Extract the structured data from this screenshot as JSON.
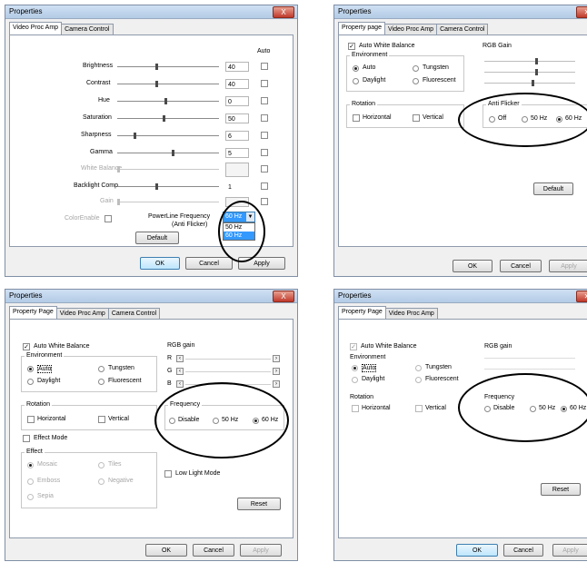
{
  "p1": {
    "title": "Properties",
    "close": "X",
    "tabs": [
      "Video Proc Amp",
      "Camera Control"
    ],
    "auto_header": "Auto",
    "rows": [
      {
        "label": "Brightness",
        "value": "40"
      },
      {
        "label": "Contrast",
        "value": "40"
      },
      {
        "label": "Hue",
        "value": "0"
      },
      {
        "label": "Saturation",
        "value": "50"
      },
      {
        "label": "Sharpness",
        "value": "6"
      },
      {
        "label": "Gamma",
        "value": "5"
      },
      {
        "label": "White Balance",
        "value": ""
      },
      {
        "label": "Backlight Comp",
        "value": "1"
      },
      {
        "label": "Gain",
        "value": ""
      }
    ],
    "color_enable": "ColorEnable",
    "powerline_label_1": "PowerLine Frequency",
    "powerline_label_2": "(Anti Flicker)",
    "powerline_value": "60 Hz",
    "powerline_options": [
      "50 Hz",
      "60 Hz"
    ],
    "default_btn": "Default",
    "ok": "OK",
    "cancel": "Cancel",
    "apply": "Apply"
  },
  "p2": {
    "title": "Properties",
    "tabs": [
      "Property page",
      "Video Proc Amp",
      "Camera Control"
    ],
    "awb": "Auto White Balance",
    "environment": "Environment",
    "auto": "Auto",
    "tungsten": "Tungsten",
    "daylight": "Daylight",
    "fluorescent": "Fluorescent",
    "rgb_gain": "RGB Gain",
    "rotation": "Rotation",
    "horizontal": "Horizontal",
    "vertical": "Vertical",
    "anti_flicker": "Anti Flicker",
    "off": "Off",
    "hz50": "50 Hz",
    "hz60": "60 Hz",
    "default_btn": "Default",
    "ok": "OK",
    "cancel": "Cancel",
    "apply": "Apply"
  },
  "p3": {
    "title": "Properties",
    "close": "X",
    "tabs": [
      "Property Page",
      "Video Proc Amp",
      "Camera Control"
    ],
    "awb": "Auto White Balance",
    "environment": "Environment",
    "auto": "Auto",
    "tungsten": "Tungsten",
    "daylight": "Daylight",
    "fluorescent": "Fluorescent",
    "rgb_gain": "RGB gain",
    "r": "R",
    "g": "G",
    "b": "B",
    "rotation": "Rotation",
    "horizontal": "Horizontal",
    "vertical": "Vertical",
    "frequency": "Frequency",
    "disable": "Disable",
    "hz50": "50 Hz",
    "hz60": "60 Hz",
    "effect_mode": "Effect Mode",
    "effect": "Effect",
    "effects": [
      "Mosaic",
      "Tiles",
      "Emboss",
      "Negative",
      "Sepia"
    ],
    "low_light": "Low Light Mode",
    "reset_btn": "Reset",
    "ok": "OK",
    "cancel": "Cancel",
    "apply": "Apply"
  },
  "p4": {
    "title": "Properties",
    "tabs": [
      "Property Page",
      "Video Proc Amp"
    ],
    "awb": "Auto White Balance",
    "environment": "Environment",
    "auto": "Auto",
    "tungsten": "Tungsten",
    "daylight": "Daylight",
    "fluorescent": "Fluorescent",
    "rgb_gain": "RGB gain",
    "rotation": "Rotation",
    "horizontal": "Horizontal",
    "vertical": "Vertical",
    "frequency": "Frequency",
    "disable": "Disable",
    "hz50": "50 Hz",
    "hz60": "60 Hz",
    "reset_btn": "Reset",
    "ok": "OK",
    "cancel": "Cancel",
    "apply": "Apply"
  }
}
